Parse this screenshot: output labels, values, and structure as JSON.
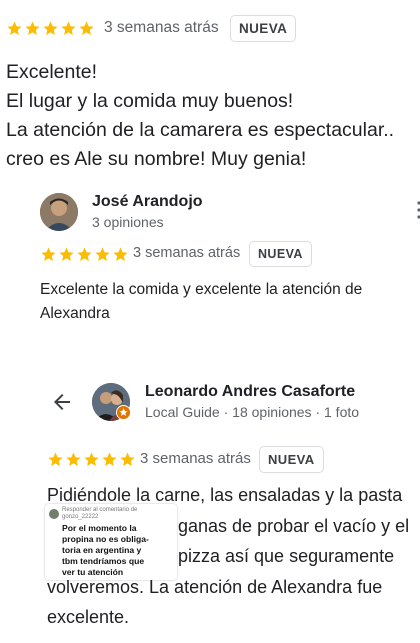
{
  "review1": {
    "time": "3 semanas atrás",
    "badge": "NUEVA",
    "text_lines": [
      "Excelente!",
      "El lugar y la comida muy buenos!",
      "La atención de la camarera es espectacular..",
      "creo es Ale su nombre! Muy genia!"
    ]
  },
  "review2": {
    "author": "José Arandojo",
    "count": "3 opiniones",
    "time": "3 semanas atrás",
    "badge": "NUEVA",
    "text_lines": [
      "Excelente la comida y excelente la atención de",
      "Alexandra"
    ]
  },
  "review3": {
    "author": "Leonardo Andres Casaforte",
    "subtitle": "Local Guide · 18 opiniones · 1 foto",
    "time": "3 semanas atrás",
    "badge": "NUEVA",
    "text_lines": [
      "Pidiéndole la carne, las ensaladas y la pasta",
      "ganas de probar el vacío y el",
      "pizza así que seguramente",
      "volveremos. La atención de Alexandra fue",
      "excelente."
    ]
  },
  "comment_overlay": {
    "title_lines": [
      "Responder al comentario de",
      "gonzo_22222"
    ],
    "text_lines": [
      "Por el momento la",
      "propina no es obliga-",
      "toria en argentina y",
      "tbm tendríamos que",
      "ver tu atención"
    ]
  },
  "rating_stars": 5,
  "colors": {
    "star": "#fbbc04",
    "text": "#202124",
    "secondary": "#5f6368"
  }
}
